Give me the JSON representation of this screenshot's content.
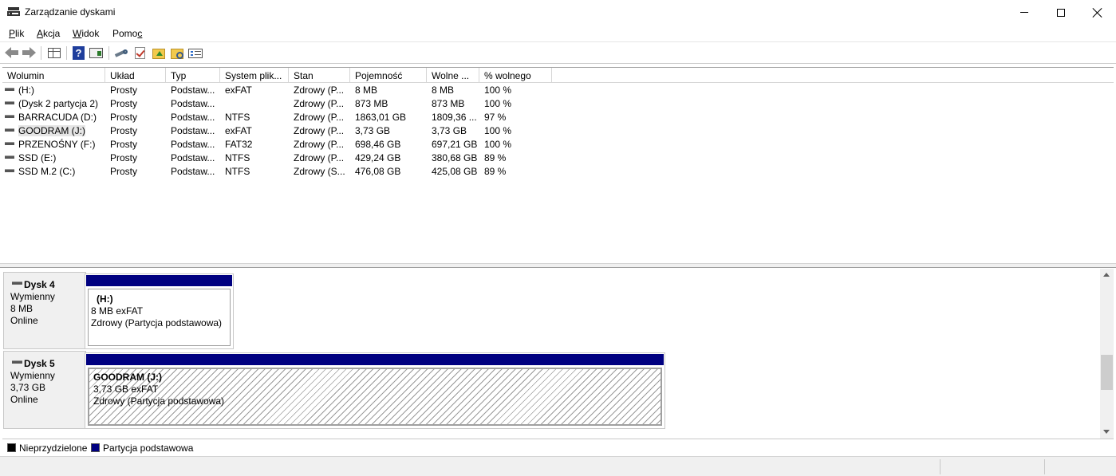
{
  "window": {
    "title": "Zarządzanie dyskami"
  },
  "menu": [
    {
      "label": "Plik",
      "underline": "P",
      "rest": "lik"
    },
    {
      "label": "Akcja",
      "underline": "A",
      "rest": "kcja"
    },
    {
      "label": "Widok",
      "underline": "W",
      "rest": "idok"
    },
    {
      "label": "Pomoc",
      "underline": "c",
      "rest": "Pomo"
    }
  ],
  "toolbar_icons": [
    "back-arrow-icon",
    "forward-arrow-icon",
    "console-tree-icon",
    "help-icon",
    "action-pane-icon",
    "connect-disk-icon",
    "check-icon",
    "folder-up-icon",
    "folder-search-icon",
    "properties-list-icon"
  ],
  "volume_list": {
    "columns": [
      "Wolumin",
      "Układ",
      "Typ",
      "System plik...",
      "Stan",
      "Pojemność",
      "Wolne ...",
      "% wolnego"
    ],
    "rows": [
      {
        "name": "(H:)",
        "layout": "Prosty",
        "type": "Podstaw...",
        "fs": "exFAT",
        "status": "Zdrowy (P...",
        "capacity": "8 MB",
        "free": "8 MB",
        "pct": "100 %"
      },
      {
        "name": "(Dysk 2 partycja 2)",
        "layout": "Prosty",
        "type": "Podstaw...",
        "fs": "",
        "status": "Zdrowy (P...",
        "capacity": "873 MB",
        "free": "873 MB",
        "pct": "100 %"
      },
      {
        "name": "BARRACUDA (D:)",
        "layout": "Prosty",
        "type": "Podstaw...",
        "fs": "NTFS",
        "status": "Zdrowy (P...",
        "capacity": "1863,01 GB",
        "free": "1809,36 ...",
        "pct": "97 %"
      },
      {
        "name": "GOODRAM (J:)",
        "layout": "Prosty",
        "type": "Podstaw...",
        "fs": "exFAT",
        "status": "Zdrowy (P...",
        "capacity": "3,73 GB",
        "free": "3,73 GB",
        "pct": "100 %"
      },
      {
        "name": "PRZENOŚNY (F:)",
        "layout": "Prosty",
        "type": "Podstaw...",
        "fs": "FAT32",
        "status": "Zdrowy (P...",
        "capacity": "698,46 GB",
        "free": "697,21 GB",
        "pct": "100 %"
      },
      {
        "name": "SSD (E:)",
        "layout": "Prosty",
        "type": "Podstaw...",
        "fs": "NTFS",
        "status": "Zdrowy (P...",
        "capacity": "429,24 GB",
        "free": "380,68 GB",
        "pct": "89 %"
      },
      {
        "name": "SSD M.2 (C:)",
        "layout": "Prosty",
        "type": "Podstaw...",
        "fs": "NTFS",
        "status": "Zdrowy (S...",
        "capacity": "476,08 GB",
        "free": "425,08 GB",
        "pct": "89 %"
      }
    ]
  },
  "disks": [
    {
      "name": "Dysk 4",
      "kind": "Wymienny",
      "size": "8 MB",
      "state": "Online",
      "partition": {
        "title": "(H:)",
        "line1": "8 MB exFAT",
        "line2": "Zdrowy (Partycja podstawowa)"
      }
    },
    {
      "name": "Dysk 5",
      "kind": "Wymienny",
      "size": "3,73 GB",
      "state": "Online",
      "partition": {
        "title": "GOODRAM  (J:)",
        "line1": "3,73 GB exFAT",
        "line2": "Zdrowy (Partycja podstawowa)"
      }
    }
  ],
  "legend": [
    {
      "label": "Nieprzydzielone",
      "color": "#000000"
    },
    {
      "label": "Partycja podstawowa",
      "color": "#000080"
    }
  ]
}
